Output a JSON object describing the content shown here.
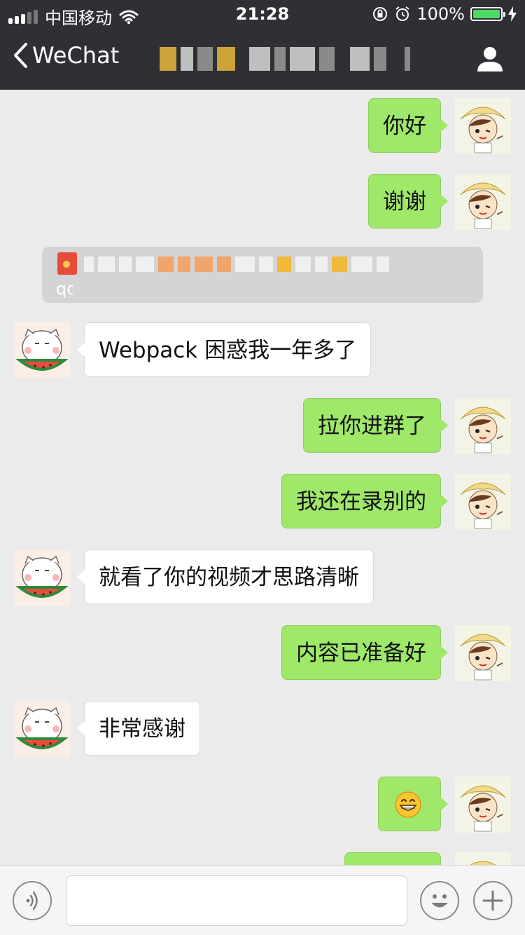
{
  "status_bar": {
    "carrier": "中国移动",
    "time": "21:28",
    "battery": "100%"
  },
  "nav": {
    "back_label": "WeChat",
    "title": "",
    "profile_icon": "person-icon"
  },
  "messages": [
    {
      "side": "me",
      "text": "你好"
    },
    {
      "side": "me",
      "text": "谢谢"
    },
    {
      "side": "system",
      "text": "qq"
    },
    {
      "side": "other",
      "text": "Webpack 困惑我一年多了"
    },
    {
      "side": "me",
      "text": "拉你进群了"
    },
    {
      "side": "me",
      "text": "我还在录别的"
    },
    {
      "side": "other",
      "text": "就看了你的视频才思路清晰"
    },
    {
      "side": "me",
      "text": "内容已准备好"
    },
    {
      "side": "other",
      "text": "非常感谢"
    },
    {
      "side": "me",
      "text": "",
      "emoji": "grinning-face"
    }
  ],
  "input_bar": {
    "voice_icon": "voice-icon",
    "emoji_icon": "smiley-icon",
    "plus_icon": "plus-icon",
    "placeholder": ""
  },
  "colors": {
    "my_bubble": "#9fe86a",
    "their_bubble": "#ffffff",
    "header": "#2f2f34",
    "background": "#ebebeb"
  }
}
